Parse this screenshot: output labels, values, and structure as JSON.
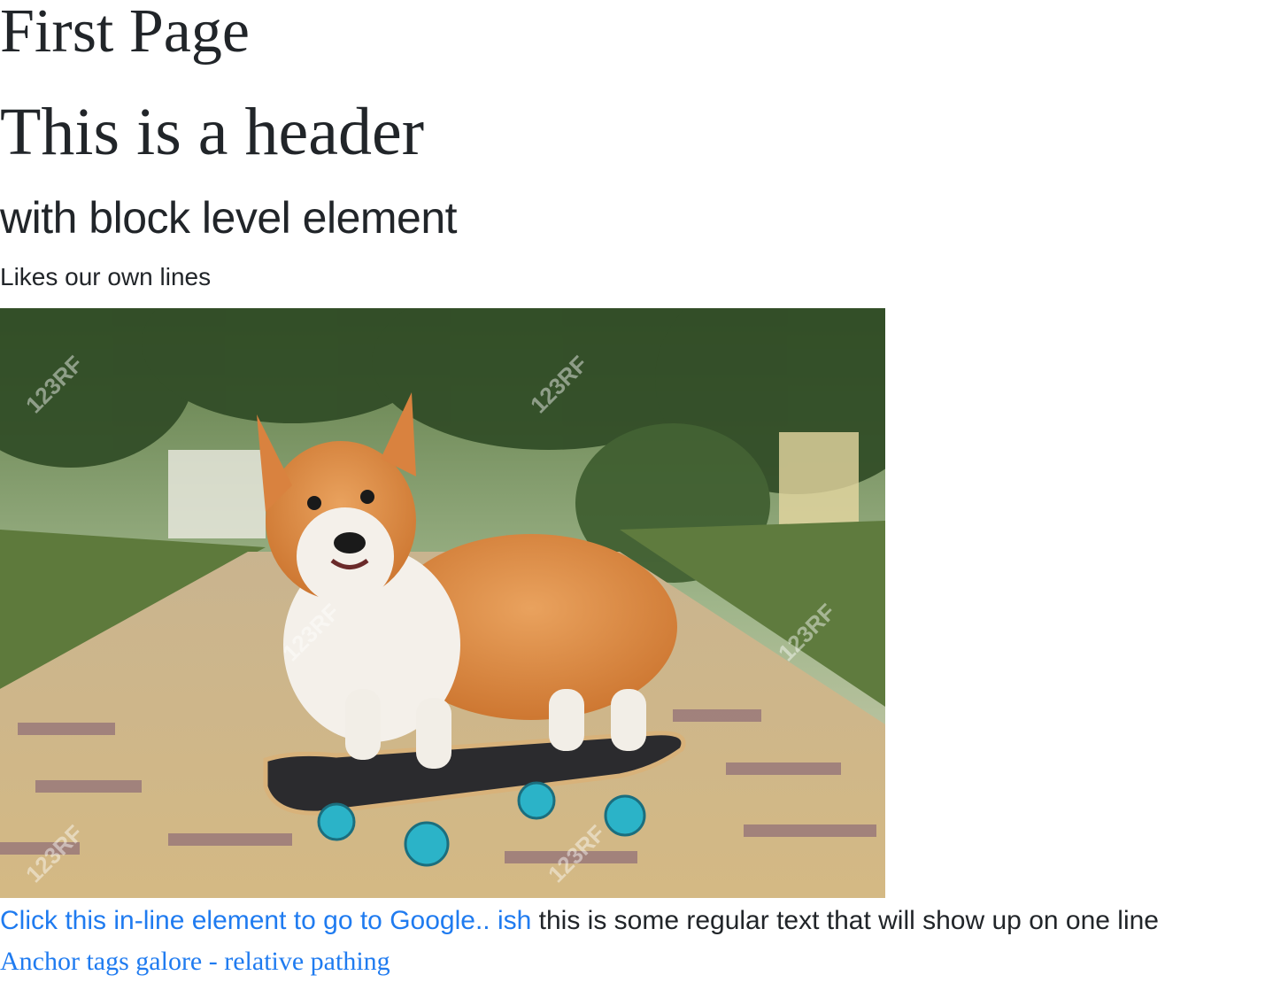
{
  "title": "First Page",
  "header": "This is a header",
  "subheader": "with block level element",
  "paragraph": "Likes our own lines",
  "image": {
    "subject": "corgi-on-skateboard",
    "watermark": "123RF"
  },
  "google_link": "Click this in-line element to go to Google.. ish",
  "regular_text": " this is some regular text that will show up on one line",
  "relative_link": "Anchor tags galore - relative pathing",
  "colors": {
    "link": "#1f7bf0",
    "text": "#212529"
  }
}
